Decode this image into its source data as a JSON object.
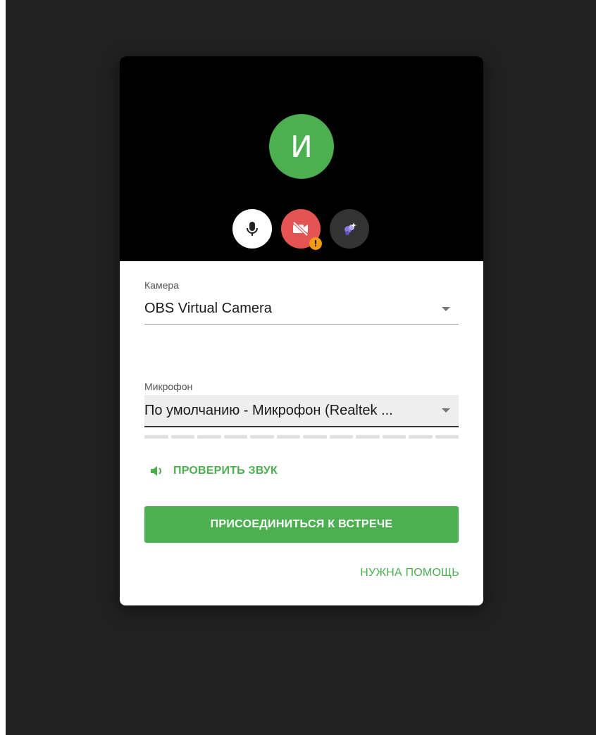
{
  "preview": {
    "avatar_initial": "И",
    "controls": {
      "mic_icon": "microphone-icon",
      "camera_icon": "camera-off-icon",
      "camera_warning": "!",
      "effects_icon": "virtual-background-icon"
    }
  },
  "camera": {
    "label": "Камера",
    "value": "OBS Virtual Camera"
  },
  "microphone": {
    "label": "Микрофон",
    "value": "По умолчанию - Микрофон (Realtek ..."
  },
  "actions": {
    "test_sound": "ПРОВЕРИТЬ ЗВУК",
    "join": "ПРИСОЕДИНИТЬСЯ К ВСТРЕЧЕ",
    "help": "НУЖНА ПОМОЩЬ"
  },
  "colors": {
    "accent": "#4caf50",
    "danger": "#e35453",
    "warning": "#f29a12",
    "background": "#212121"
  }
}
